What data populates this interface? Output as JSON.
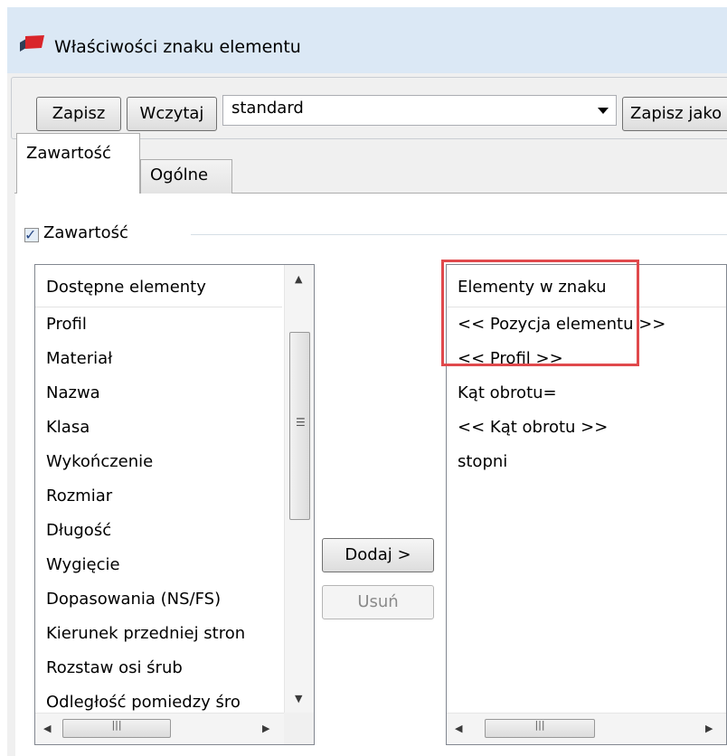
{
  "window": {
    "title": "Właściwości znaku elementu"
  },
  "toolbar": {
    "save_label": "Zapisz",
    "load_label": "Wczytaj",
    "preset_value": "standard",
    "save_as_label": "Zapisz jako"
  },
  "tabs": [
    {
      "label": "Zawartość",
      "active": true
    },
    {
      "label": "Ogólne",
      "active": false
    }
  ],
  "content_group": {
    "label": "Zawartość",
    "checked": true
  },
  "available": {
    "header": "Dostępne elementy",
    "items": [
      "Profil",
      "Materiał",
      "Nazwa",
      "Klasa",
      "Wykończenie",
      "Rozmiar",
      "Długość",
      "Wygięcie",
      "Dopasowania (NS/FS)",
      "Kierunek przedniej stron",
      "Rozstaw osi śrub",
      "Odległość pomiedzy śro"
    ]
  },
  "selected": {
    "header": "Elementy w znaku",
    "items": [
      "<< Pozycja elementu >>",
      "<< Profil >>",
      "Kąt obrotu=",
      "<< Kąt obrotu >>",
      "stopni"
    ]
  },
  "actions": {
    "add_label": "Dodaj >",
    "remove_label": "Usuń"
  },
  "colors": {
    "highlight": "#e0494c",
    "titlebar": "#dbe8f5"
  }
}
